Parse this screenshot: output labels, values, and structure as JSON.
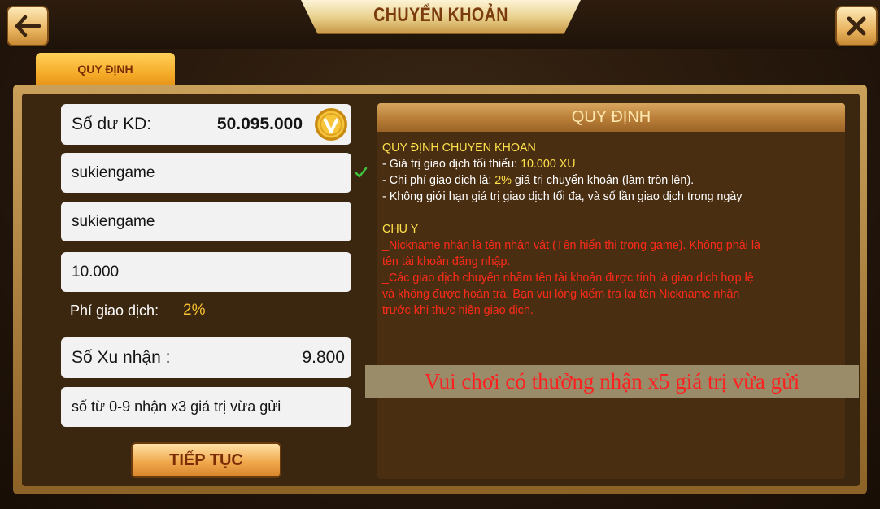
{
  "header": {
    "title": "CHUYỂN KHOẢN"
  },
  "tabs": [
    {
      "label": "QUY ĐỊNH"
    }
  ],
  "form": {
    "balance_label": "Số dư KD:",
    "balance_value": "50.095.000",
    "receiver_nickname": "sukiengame",
    "receiver_confirm": "sukiengame",
    "amount": "10.000",
    "fee_label": "Phí giao dịch:",
    "fee_value": "2%",
    "received_label": "Số Xu nhận :",
    "received_value": "9.800",
    "message": "số từ 0-9 nhận x3 giá trị vừa gửi",
    "continue_label": "TIẾP TỤC"
  },
  "rules": {
    "header": "QUY ĐỊNH",
    "section_title": "QUY ĐỊNH CHUYEN KHOAN",
    "min_prefix": "- Giá trị giao dịch tối thiểu: ",
    "min_value": "10.000 XU",
    "fee_prefix": "- Chi phí giao dịch là: ",
    "fee_value": "2%",
    "fee_suffix": " giá trị chuyển khoản (làm tròn lên).",
    "no_limit": "- Không giới hạn giá trị giao dịch tối đa, và số lần giao dịch trong ngày",
    "note_title": "CHU Y",
    "note_lines": [
      "_Nickname nhận là tên nhận vật (Tên hiển thị trong game). Không phải là",
      "tên tài khoản đăng nhập.",
      "_Các giao dịch chuyển nhầm tên tài khoản được tính là giao dịch hợp lệ",
      "và không được hoàn trả. Bạn vui lòng kiểm tra lại tên Nickname nhận",
      "trước khi thực hiện giao dịch."
    ]
  },
  "banner": {
    "text": "Vui chơi có thưởng nhận x5 giá trị vừa gửi"
  },
  "colors": {
    "accent_gold": "#f5c030",
    "warning_red": "#ff2a1a",
    "rule_yellow": "#ffe24a"
  },
  "icons": {
    "back": "back-arrow-icon",
    "close": "close-icon",
    "coin": "coin-icon",
    "check": "check-icon"
  }
}
